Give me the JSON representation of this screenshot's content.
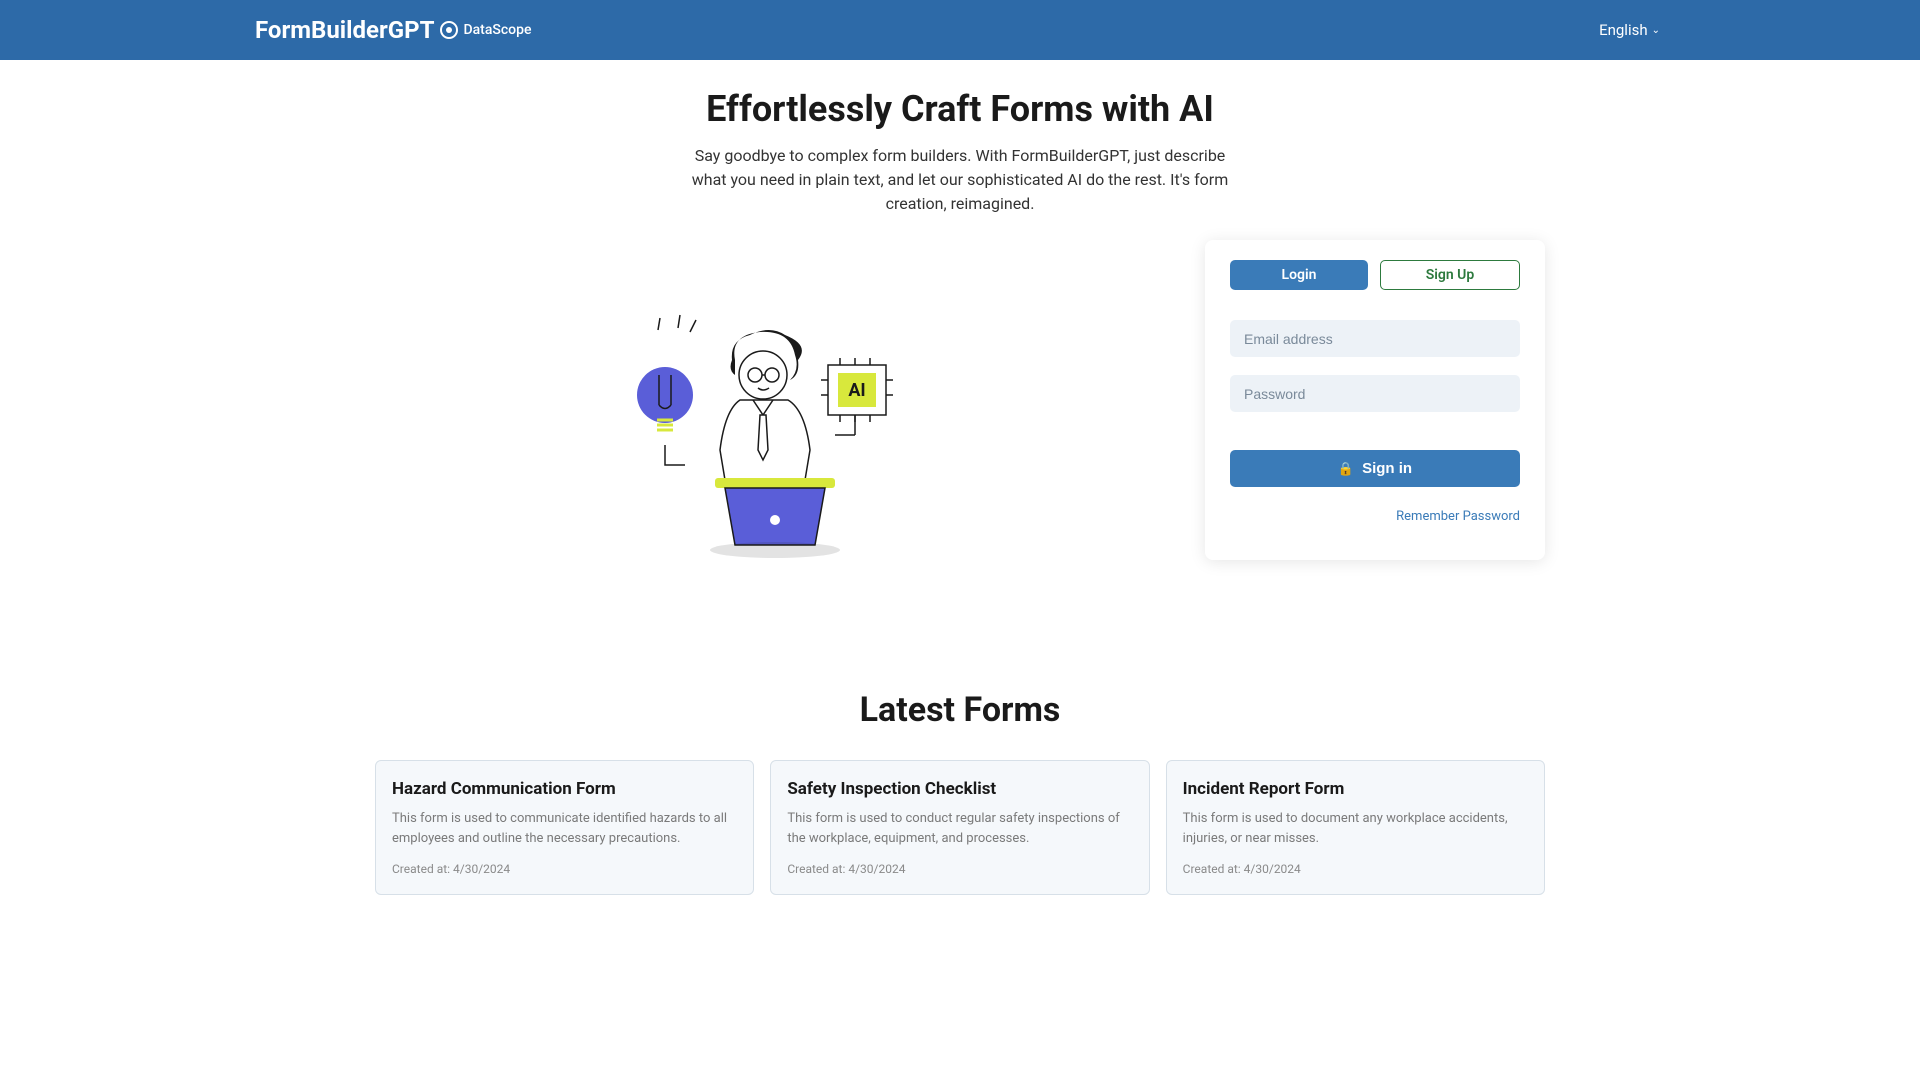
{
  "header": {
    "logo": "FormBuilderGPT",
    "partner": "DataScope",
    "language": "English"
  },
  "hero": {
    "title": "Effortlessly Craft Forms with AI",
    "subtitle": "Say goodbye to complex form builders. With FormBuilderGPT, just describe what you need in plain text, and let our sophisticated AI do the rest. It's form creation, reimagined."
  },
  "auth": {
    "login_tab": "Login",
    "signup_tab": "Sign Up",
    "email_placeholder": "Email address",
    "password_placeholder": "Password",
    "signin_btn": "Sign in",
    "remember_link": "Remember Password"
  },
  "latest": {
    "title": "Latest Forms",
    "cards": [
      {
        "title": "Hazard Communication Form",
        "desc": "This form is used to communicate identified hazards to all employees and outline the necessary precautions.",
        "date": "Created at: 4/30/2024"
      },
      {
        "title": "Safety Inspection Checklist",
        "desc": "This form is used to conduct regular safety inspections of the workplace, equipment, and processes.",
        "date": "Created at: 4/30/2024"
      },
      {
        "title": "Incident Report Form",
        "desc": "This form is used to document any workplace accidents, injuries, or near misses.",
        "date": "Created at: 4/30/2024"
      }
    ]
  }
}
